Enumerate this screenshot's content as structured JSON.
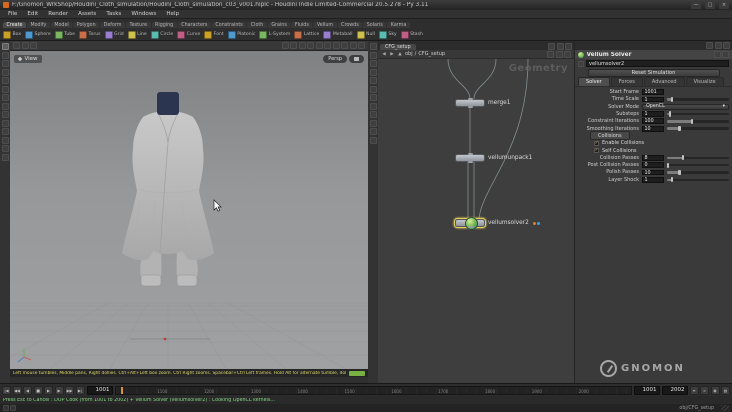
{
  "titlebar": {
    "title": "F:/Gnomon_WrkShop/Houdini_Cloth_simulation/Houdini_Cloth_simulation_c03_v001.hiplc - Houdini Indie Limited-Commercial 20.5.278 - Py 3.11"
  },
  "menubar": {
    "items": [
      "File",
      "Edit",
      "Render",
      "Assets",
      "Tasks",
      "Windows",
      "Help"
    ]
  },
  "shelf": {
    "active_tab": "Create",
    "tabs": [
      "Create",
      "Modify",
      "Model",
      "Polygon",
      "Deform",
      "Texture",
      "Rigging",
      "Characters",
      "Constraints",
      "Cloth",
      "Grains",
      "Fluids",
      "Vellum",
      "Crowds",
      "Solaris",
      "Karma"
    ],
    "tools": [
      {
        "label": "Box"
      },
      {
        "label": "Sphere"
      },
      {
        "label": "Tube"
      },
      {
        "label": "Torus"
      },
      {
        "label": "Grid"
      },
      {
        "label": "Line"
      },
      {
        "label": "Circle"
      },
      {
        "label": "Curve"
      },
      {
        "label": "Font"
      },
      {
        "label": "Platonic"
      },
      {
        "label": "L-System"
      },
      {
        "label": "Lattice"
      },
      {
        "label": "Metaball"
      },
      {
        "label": "Null"
      },
      {
        "label": "Sky"
      },
      {
        "label": "Stash"
      }
    ]
  },
  "viewport": {
    "badge": "View",
    "persp_label": "Persp",
    "help_text": "Left mouse tumbles, Middle pans, Right dollies. Ctrl+Alt+Left box zoom. Ctrl Right zooms. Spacebar+Ctrl Left frames. Hold Alt for alternate tumble, dolly and zoom. N or Alt+N for First Person Navigation",
    "pane_icons": [
      "pane-menu",
      "maximize-pane",
      "split-pane"
    ],
    "left_tools": [
      "select-tool",
      "translate-tool",
      "rotate-tool",
      "scale-tool",
      "pose-tool",
      "handles-tool",
      "snap-tool",
      "align-tool",
      "view-tool",
      "walk-tool",
      "info-tool",
      "measure-tool",
      "render-region-tool",
      "flipbook-tool"
    ],
    "right_tools": [
      "display-points",
      "display-primitives",
      "wireframe-display",
      "shaded-display",
      "smooth-shade-display",
      "material-display",
      "lights-display",
      "grid-display",
      "normals-display",
      "vectors-display",
      "visualizers",
      "snapshot"
    ],
    "top_tools": [
      "snap-grid",
      "snap-points",
      "snap-prims",
      "construction-plane",
      "points-from-view",
      "select-mode",
      "objects-mode",
      "shade-mode",
      "display-options",
      "viewport-layout"
    ]
  },
  "network": {
    "pane_tab": "CFG_setup",
    "path_root": "obj",
    "path_node": "CFG_setup",
    "context_label": "Geometry",
    "pane_icons": [
      "pane-menu",
      "maximize-pane",
      "split-pane"
    ],
    "toolbar_icons": [
      "network-overview",
      "network-snapshot",
      "network-display-options"
    ],
    "nodes": [
      {
        "name": "merge1",
        "type": "merge",
        "selected": false
      },
      {
        "name": "vellumunpack1",
        "type": "vellum-unpack",
        "selected": false
      },
      {
        "name": "vellumsolver2",
        "type": "vellum-solver",
        "selected": true
      }
    ]
  },
  "params": {
    "title": "Vellum Solver",
    "name": "vellumsolver2",
    "reset_label": "Reset Simulation",
    "tabs": [
      "Solver",
      "Forces",
      "Advanced",
      "Visualize"
    ],
    "active_tab": "Solver",
    "pane_icons": [
      "pane-menu",
      "maximize-pane",
      "split-pane"
    ],
    "header_icons": [
      "pin-icon",
      "gear-icon"
    ],
    "rows": [
      {
        "t": "field",
        "label": "Start Frame",
        "value": "1001"
      },
      {
        "t": "slider",
        "label": "Time Scale",
        "value": "1",
        "f": 0.08
      },
      {
        "t": "menu",
        "label": "Solver Mode",
        "value": "OpenCL"
      },
      {
        "t": "slider",
        "label": "Substeps",
        "value": "1",
        "f": 0.05
      },
      {
        "t": "slider",
        "label": "Constraint Iterations",
        "value": "100",
        "f": 0.4
      },
      {
        "t": "slider",
        "label": "Smoothing Iterations",
        "value": "10",
        "f": 0.2
      },
      {
        "t": "section",
        "label": "Collisions"
      },
      {
        "t": "toggle",
        "label": "Enable Collisions",
        "on": true
      },
      {
        "t": "toggle",
        "label": "Self Collisions",
        "on": true
      },
      {
        "t": "slider",
        "label": "Collision Passes",
        "value": "8",
        "f": 0.25
      },
      {
        "t": "slider",
        "label": "Post Collision Passes",
        "value": "0",
        "f": 0.02
      },
      {
        "t": "slider",
        "label": "Polish Passes",
        "value": "10",
        "f": 0.2
      },
      {
        "t": "slider",
        "label": "Layer Shock",
        "value": "1",
        "f": 0.08
      }
    ]
  },
  "playbar": {
    "frame": "1001",
    "range_start": "1001",
    "range_end": "2002",
    "tick_labels": [
      "1100",
      "1200",
      "1300",
      "1400",
      "1500",
      "1600",
      "1700",
      "1800",
      "1900",
      "2000"
    ]
  },
  "statusbar": {
    "cook_message": "Press Esc to Cancel : DOP Cook (from 1001 to 2002)   +  Vellum Solver (vellumsolver2) : Cooking OpenCL kernels...",
    "context": "obj/CFG_setup"
  },
  "watermark": {
    "text": "GNOMON"
  },
  "colors": {
    "accent_orange": "#e09132",
    "node_green": "#6cb34f",
    "help_yellow": "#ded86a",
    "cook_green": "#84d884",
    "flag_orange": "#e07b2a",
    "flag_blue": "#3fa0d8"
  }
}
